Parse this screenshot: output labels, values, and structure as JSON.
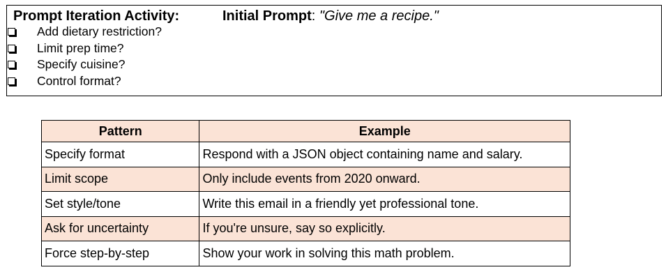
{
  "activity": {
    "title": "Prompt Iteration Activity:",
    "initial_prompt_label": "Initial Prompt",
    "initial_prompt_separator": ": ",
    "initial_prompt_text": "\"Give me a recipe.\"",
    "checklist": [
      "Add dietary restriction?",
      "Limit prep time?",
      "Specify cuisine?",
      "Control format?"
    ]
  },
  "table": {
    "headers": [
      "Pattern",
      "Example"
    ],
    "rows": [
      [
        "Specify format",
        "Respond with a JSON object containing name and salary."
      ],
      [
        "Limit scope",
        "Only include events from 2020 onward."
      ],
      [
        "Set style/tone",
        "Write this email in a friendly yet professional tone."
      ],
      [
        "Ask for uncertainty",
        "If you're unsure, say so explicitly."
      ],
      [
        "Force step-by-step",
        "Show your work in solving this math problem."
      ]
    ],
    "shaded_row_color": "#fbe3d6"
  }
}
